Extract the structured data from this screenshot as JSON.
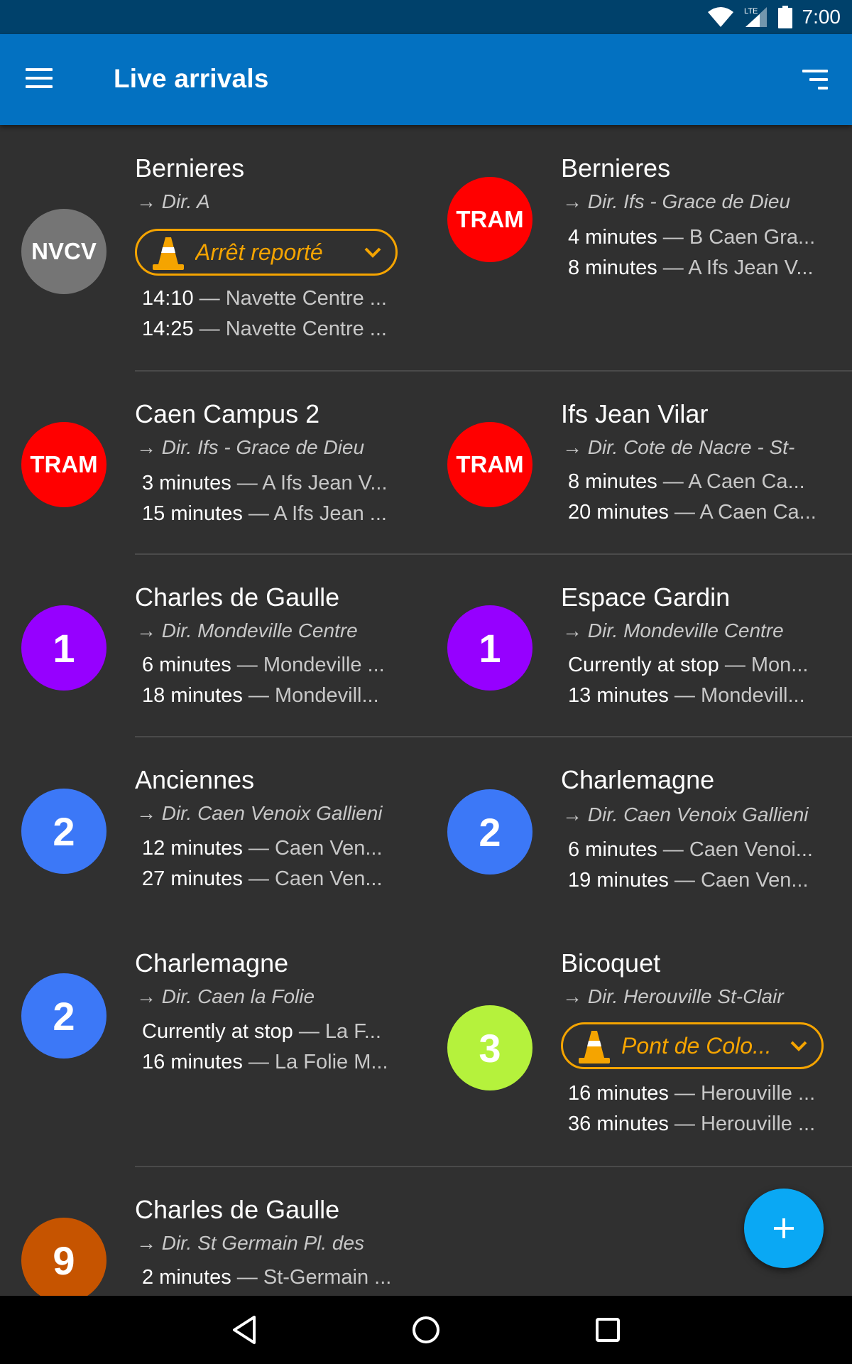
{
  "status_bar": {
    "time": "7:00",
    "network": "LTE",
    "icons": [
      "wifi-icon",
      "signal-icon",
      "battery-icon"
    ]
  },
  "app_bar": {
    "title": "Live arrivals",
    "menu_icon": "menu-icon",
    "sort_icon": "sort-icon"
  },
  "colors": {
    "status_bar": "#00416b",
    "app_bar": "#0371c1",
    "background": "#303030",
    "alert": "#f5a400",
    "fab": "#0aa8f4"
  },
  "cards": [
    {
      "badge": "NVCV",
      "badge_color": "#757575",
      "stop": "Bernieres",
      "direction": "→ Dir. A",
      "alert": "Arrêt reporté",
      "arrivals": [
        {
          "time": "14:10",
          "dest": "— Navette Centre ..."
        },
        {
          "time": "14:25",
          "dest": "— Navette Centre ..."
        }
      ]
    },
    {
      "badge": "TRAM",
      "badge_color": "#ff0000",
      "stop": "Bernieres",
      "direction": "→ Dir. Ifs - Grace de Dieu",
      "arrivals": [
        {
          "time": "4 minutes",
          "dest": "— B Caen Gra..."
        },
        {
          "time": "8 minutes",
          "dest": "— A Ifs Jean V..."
        }
      ]
    },
    {
      "badge": "TRAM",
      "badge_color": "#ff0000",
      "stop": "Caen Campus 2",
      "direction": "→ Dir. Ifs - Grace de Dieu",
      "arrivals": [
        {
          "time": "3 minutes",
          "dest": "— A Ifs Jean V..."
        },
        {
          "time": "15 minutes",
          "dest": "— A Ifs Jean ..."
        }
      ]
    },
    {
      "badge": "TRAM",
      "badge_color": "#ff0000",
      "stop": "Ifs Jean Vilar",
      "direction": "→ Dir. Cote de Nacre - St-",
      "arrivals": [
        {
          "time": "8 minutes",
          "dest": "— A Caen Ca..."
        },
        {
          "time": "20 minutes",
          "dest": "— A Caen Ca..."
        }
      ]
    },
    {
      "badge": "1",
      "badge_color": "#9600ff",
      "stop": "Charles de Gaulle",
      "direction": "→ Dir. Mondeville Centre",
      "arrivals": [
        {
          "time": "6 minutes",
          "dest": "— Mondeville ..."
        },
        {
          "time": "18 minutes",
          "dest": "— Mondevill..."
        }
      ]
    },
    {
      "badge": "1",
      "badge_color": "#9600ff",
      "stop": "Espace Gardin",
      "direction": "→ Dir. Mondeville Centre",
      "arrivals": [
        {
          "time": "Currently at stop",
          "dest": "— Mon..."
        },
        {
          "time": "13 minutes",
          "dest": "— Mondevill..."
        }
      ]
    },
    {
      "badge": "2",
      "badge_color": "#3c78f7",
      "stop": "Anciennes",
      "direction": "→ Dir. Caen Venoix Gallieni",
      "arrivals": [
        {
          "time": "12 minutes",
          "dest": "— Caen Ven..."
        },
        {
          "time": "27 minutes",
          "dest": "— Caen Ven..."
        }
      ]
    },
    {
      "badge": "2",
      "badge_color": "#3c78f7",
      "stop": "Charlemagne",
      "direction": "→ Dir. Caen Venoix Gallieni",
      "arrivals": [
        {
          "time": "6 minutes",
          "dest": "— Caen Venoi..."
        },
        {
          "time": "19 minutes",
          "dest": "— Caen Ven..."
        }
      ]
    },
    {
      "badge": "2",
      "badge_color": "#3c78f7",
      "stop": "Charlemagne",
      "direction": "→ Dir. Caen la Folie",
      "arrivals": [
        {
          "time": "Currently at stop",
          "dest": "— La F..."
        },
        {
          "time": "16 minutes",
          "dest": "— La Folie M..."
        }
      ]
    },
    {
      "badge": "3",
      "badge_color": "#b5f23c",
      "stop": "Bicoquet",
      "direction": "→ Dir. Herouville St-Clair",
      "alert": "Pont de Colo...",
      "arrivals": [
        {
          "time": "16 minutes",
          "dest": "— Herouville ..."
        },
        {
          "time": "36 minutes",
          "dest": "— Herouville ..."
        }
      ]
    },
    {
      "badge": "9",
      "badge_color": "#c65400",
      "stop": "Charles de Gaulle",
      "direction": "→ Dir. St Germain Pl. des",
      "arrivals": [
        {
          "time": "2 minutes",
          "dest": "— St-Germain ..."
        }
      ]
    }
  ],
  "fab": {
    "icon": "plus-icon"
  },
  "nav_bar": {
    "icons": [
      "back-icon",
      "home-icon",
      "recents-icon"
    ]
  }
}
